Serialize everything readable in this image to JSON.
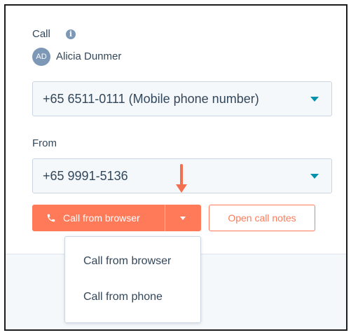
{
  "call_section": {
    "label": "Call",
    "info_icon": "info-icon"
  },
  "contact": {
    "avatar_initials": "AD",
    "name": "Alicia Dunmer"
  },
  "to_select": {
    "value": "+65 6511-0111 (Mobile phone number)"
  },
  "from_section": {
    "label": "From",
    "value": "+65 9991-5136"
  },
  "actions": {
    "call_button_label": "Call from browser",
    "call_button_icon": "phone-icon",
    "notes_button_label": "Open call notes"
  },
  "dropdown": {
    "items": [
      {
        "label": "Call from browser"
      },
      {
        "label": "Call from phone"
      }
    ]
  },
  "colors": {
    "accent": "#ff7a59",
    "link": "#0091ae",
    "text": "#33475b",
    "annotation_arrow": "#f2704f"
  }
}
